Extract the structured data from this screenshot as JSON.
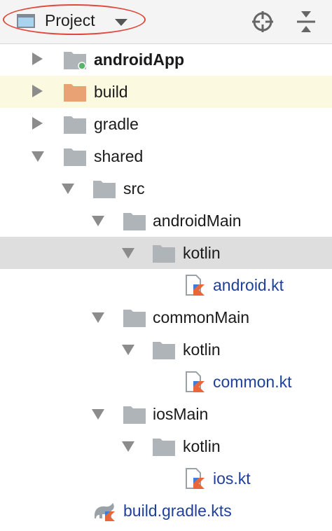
{
  "toolbar": {
    "view_selector_label": "Project",
    "view_icon": "project-view-icon",
    "dropdown_icon": "chevron-down-icon",
    "locate_icon": "crosshair-locate-icon",
    "collapse_icon": "collapse-all-icon",
    "accent_color": "#e0483b"
  },
  "tree": [
    {
      "label": "androidApp",
      "bold": true
    },
    {
      "label": "build"
    },
    {
      "label": "gradle"
    },
    {
      "label": "shared"
    },
    {
      "label": "src"
    },
    {
      "label": "androidMain"
    },
    {
      "label": "kotlin"
    },
    {
      "label": "android.kt"
    },
    {
      "label": "commonMain"
    },
    {
      "label": "kotlin"
    },
    {
      "label": "common.kt"
    },
    {
      "label": "iosMain"
    },
    {
      "label": "kotlin"
    },
    {
      "label": "ios.kt"
    },
    {
      "label": "build.gradle.kts"
    }
  ]
}
